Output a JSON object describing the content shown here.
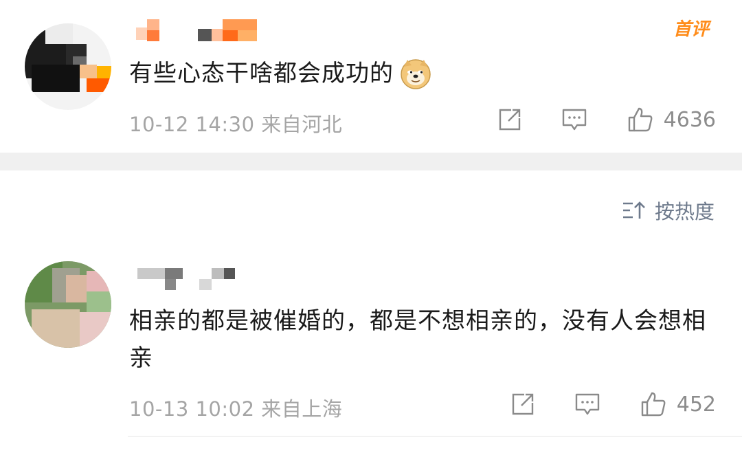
{
  "comments": [
    {
      "badge": "首评",
      "text": "有些心态干啥都会成功的",
      "emoji": "doge-emoji",
      "time": "10-12 14:30",
      "location": "来自河北",
      "likes": "4636"
    },
    {
      "text": "相亲的都是被催婚的，都是不想相亲的，没有人会想相亲",
      "time": "10-13 10:02",
      "location": "来自上海",
      "likes": "452"
    }
  ],
  "sort": {
    "label": "按热度",
    "icon": "sort-icon"
  },
  "icons": {
    "share": "share-icon",
    "reply": "reply-icon",
    "like": "like-icon"
  },
  "colors": {
    "badge": "#ff8c1a",
    "meta": "#a5a5a5",
    "sort": "#6e7a8c",
    "divider": "#f0f0f0"
  }
}
